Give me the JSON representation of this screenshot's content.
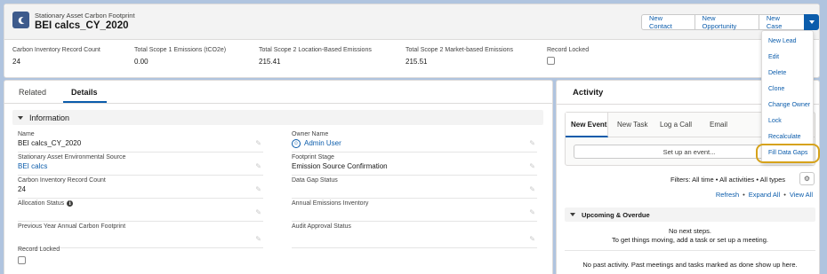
{
  "header": {
    "object_type": "Stationary Asset Carbon Footprint",
    "record_name": "BEI calcs_CY_2020",
    "buttons": {
      "new_contact": "New Contact",
      "new_opportunity": "New Opportunity",
      "new_case": "New Case"
    },
    "highlights": [
      {
        "label": "Carbon Inventory Record Count",
        "value": "24"
      },
      {
        "label": "Total Scope 1 Emissions (tCO2e)",
        "value": "0.00"
      },
      {
        "label": "Total Scope 2 Location-Based Emissions",
        "value": "215.41"
      },
      {
        "label": "Total Scope 2 Market-based Emissions",
        "value": "215.51"
      },
      {
        "label": "Record Locked",
        "value": ""
      }
    ]
  },
  "menu": {
    "items": [
      "New Lead",
      "Edit",
      "Delete",
      "Clone",
      "Change Owner",
      "Lock",
      "Recalculate",
      "Fill Data Gaps"
    ]
  },
  "tabs": {
    "related": "Related",
    "details": "Details"
  },
  "section": {
    "title": "Information"
  },
  "fields": {
    "name": {
      "label": "Name",
      "value": "BEI calcs_CY_2020"
    },
    "owner": {
      "label": "Owner Name",
      "value": "Admin User"
    },
    "source": {
      "label": "Stationary Asset Environmental Source",
      "value": "BEI calcs"
    },
    "stage": {
      "label": "Footprint Stage",
      "value": "Emission Source Confirmation"
    },
    "count": {
      "label": "Carbon Inventory Record Count",
      "value": "24"
    },
    "gap": {
      "label": "Data Gap Status",
      "value": ""
    },
    "allocation": {
      "label": "Allocation Status",
      "value": ""
    },
    "annual": {
      "label": "Annual Emissions Inventory",
      "value": ""
    },
    "prev": {
      "label": "Previous Year Annual Carbon Footprint",
      "value": ""
    },
    "audit": {
      "label": "Audit Approval Status",
      "value": ""
    },
    "locked": {
      "label": "Record Locked",
      "value": ""
    }
  },
  "activity": {
    "title": "Activity",
    "composer_tabs": [
      "New Event",
      "New Task",
      "Log a Call",
      "Email"
    ],
    "setup_placeholder": "Set up an event...",
    "filters": "Filters: All time • All activities • All types",
    "links": [
      "Refresh",
      "Expand All",
      "View All"
    ],
    "upcoming_title": "Upcoming & Overdue",
    "no_steps": "No next steps.",
    "hint": "To get things moving, add a task or set up a meeting.",
    "no_past": "No past activity. Past meetings and tasks marked as done show up here."
  },
  "colors": {
    "brand": "#0b5cab",
    "highlight_outline": "#d6a21a",
    "object_icon": "#3e5b8c"
  }
}
